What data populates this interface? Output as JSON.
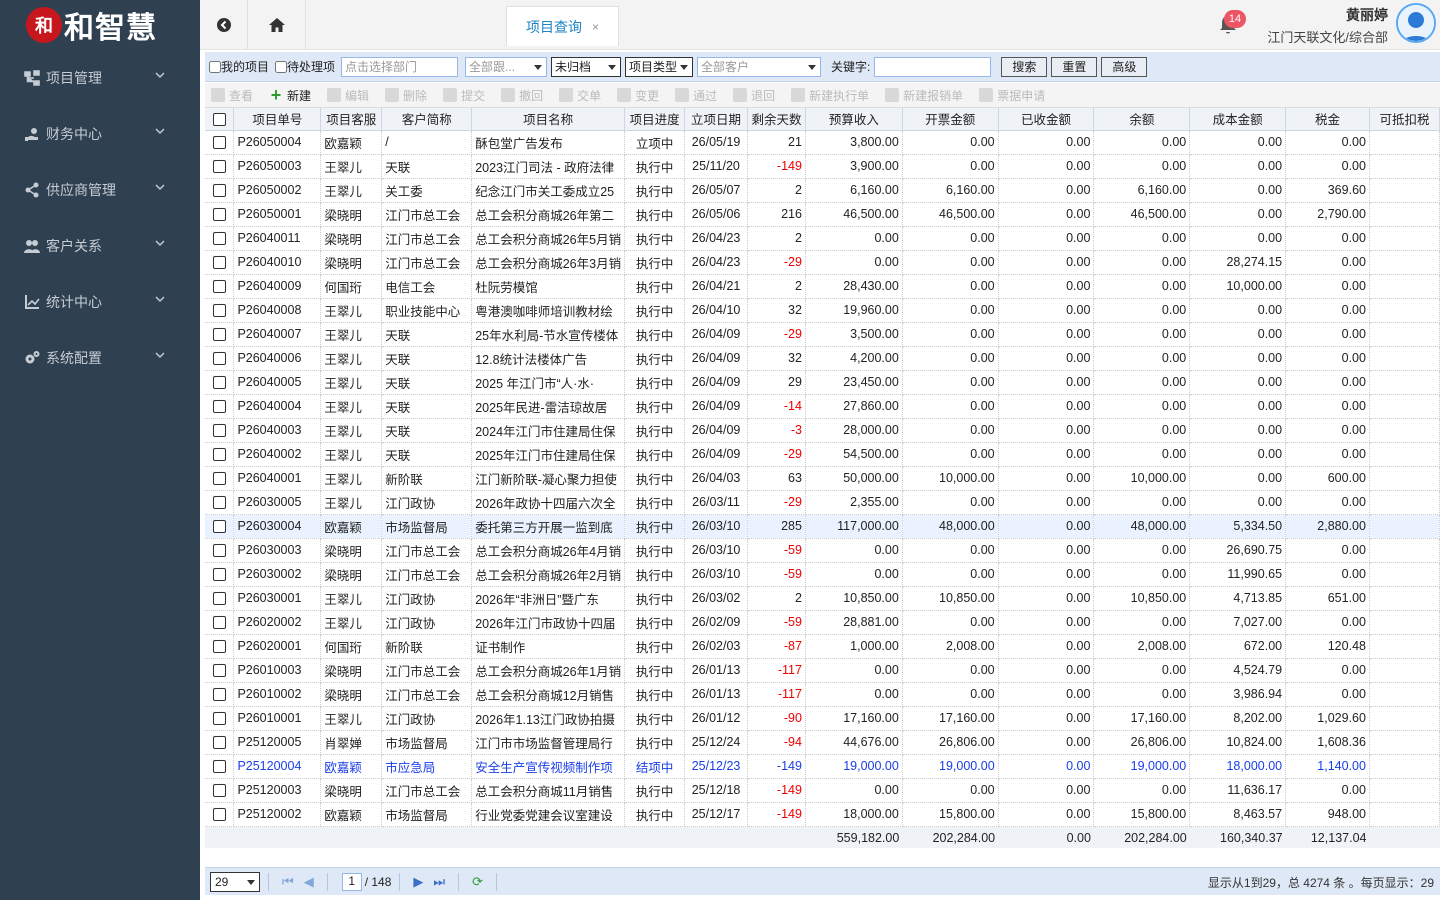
{
  "app": {
    "logo_mark": "和",
    "logo_text": "和智慧"
  },
  "sidebar": {
    "items": [
      {
        "label": "项目管理",
        "icon": "sitemap-icon"
      },
      {
        "label": "财务中心",
        "icon": "hand-money-icon"
      },
      {
        "label": "供应商管理",
        "icon": "share-icon"
      },
      {
        "label": "客户关系",
        "icon": "users-icon"
      },
      {
        "label": "统计中心",
        "icon": "chart-icon"
      },
      {
        "label": "系统配置",
        "icon": "gears-icon"
      }
    ]
  },
  "header": {
    "tab_label": "项目查询",
    "tab_close": "×",
    "notif_count": "14",
    "user_name": "黄丽婷",
    "user_org": "江门天联文化/综合部"
  },
  "filter": {
    "my_projects": "我的项目",
    "pending": "待处理项",
    "dept_placeholder": "点击选择部门",
    "follow": "全部跟...",
    "archive": "未归档",
    "type": "项目类型",
    "client": "全部客户",
    "keyword_label": "关键字:",
    "search": "搜索",
    "reset": "重置",
    "advanced": "高级"
  },
  "toolbar": {
    "items": [
      {
        "label": "查看",
        "enabled": false
      },
      {
        "label": "新建",
        "enabled": true
      },
      {
        "label": "编辑",
        "enabled": false
      },
      {
        "label": "删除",
        "enabled": false
      },
      {
        "label": "提交",
        "enabled": false
      },
      {
        "label": "撤回",
        "enabled": false
      },
      {
        "label": "交单",
        "enabled": false
      },
      {
        "label": "变更",
        "enabled": false
      },
      {
        "label": "通过",
        "enabled": false
      },
      {
        "label": "退回",
        "enabled": false
      },
      {
        "label": "新建执行单",
        "enabled": false
      },
      {
        "label": "新建报销单",
        "enabled": false
      },
      {
        "label": "票据申请",
        "enabled": false
      }
    ]
  },
  "table": {
    "columns": [
      "项目单号",
      "项目客服",
      "客户简称",
      "项目名称",
      "项目进度",
      "立项日期",
      "剩余天数",
      "预算收入",
      "开票金额",
      "已收金额",
      "余额",
      "成本金额",
      "税金",
      "可抵扣税"
    ],
    "rows": [
      [
        "P26050004",
        "欧嘉颖",
        "/",
        "酥包堂广告发布",
        "立项中",
        "26/05/19",
        "21",
        "3,800.00",
        "0.00",
        "0.00",
        "0.00",
        "0.00",
        "0.00",
        ""
      ],
      [
        "P26050003",
        "王翠儿",
        "天联",
        "2023江门司法 - 政府法律",
        "执行中",
        "25/11/20",
        "-149",
        "3,900.00",
        "0.00",
        "0.00",
        "0.00",
        "0.00",
        "0.00",
        ""
      ],
      [
        "P26050002",
        "王翠儿",
        "关工委",
        "纪念江门市关工委成立25",
        "执行中",
        "26/05/07",
        "2",
        "6,160.00",
        "6,160.00",
        "0.00",
        "6,160.00",
        "0.00",
        "369.60",
        ""
      ],
      [
        "P26050001",
        "梁晓明",
        "江门市总工会",
        "总工会积分商城26年第二",
        "执行中",
        "26/05/06",
        "216",
        "46,500.00",
        "46,500.00",
        "0.00",
        "46,500.00",
        "0.00",
        "2,790.00",
        ""
      ],
      [
        "P26040011",
        "梁晓明",
        "江门市总工会",
        "总工会积分商城26年5月销",
        "执行中",
        "26/04/23",
        "2",
        "0.00",
        "0.00",
        "0.00",
        "0.00",
        "0.00",
        "0.00",
        ""
      ],
      [
        "P26040010",
        "梁晓明",
        "江门市总工会",
        "总工会积分商城26年3月销",
        "执行中",
        "26/04/23",
        "-29",
        "0.00",
        "0.00",
        "0.00",
        "0.00",
        "28,274.15",
        "0.00",
        ""
      ],
      [
        "P26040009",
        "何国珩",
        "电信工会",
        "杜阮劳模馆",
        "执行中",
        "26/04/21",
        "2",
        "28,430.00",
        "0.00",
        "0.00",
        "0.00",
        "10,000.00",
        "0.00",
        ""
      ],
      [
        "P26040008",
        "王翠儿",
        "职业技能中心",
        "粤港澳咖啡师培训教材绘",
        "执行中",
        "26/04/10",
        "32",
        "19,960.00",
        "0.00",
        "0.00",
        "0.00",
        "0.00",
        "0.00",
        ""
      ],
      [
        "P26040007",
        "王翠儿",
        "天联",
        "25年水利局-节水宣传楼体",
        "执行中",
        "26/04/09",
        "-29",
        "3,500.00",
        "0.00",
        "0.00",
        "0.00",
        "0.00",
        "0.00",
        ""
      ],
      [
        "P26040006",
        "王翠儿",
        "天联",
        "12.8统计法楼体广告",
        "执行中",
        "26/04/09",
        "32",
        "4,200.00",
        "0.00",
        "0.00",
        "0.00",
        "0.00",
        "0.00",
        ""
      ],
      [
        "P26040005",
        "王翠儿",
        "天联",
        "2025 年江门市“人·水·",
        "执行中",
        "26/04/09",
        "29",
        "23,450.00",
        "0.00",
        "0.00",
        "0.00",
        "0.00",
        "0.00",
        ""
      ],
      [
        "P26040004",
        "王翠儿",
        "天联",
        "2025年民进-雷洁琼故居",
        "执行中",
        "26/04/09",
        "-14",
        "27,860.00",
        "0.00",
        "0.00",
        "0.00",
        "0.00",
        "0.00",
        ""
      ],
      [
        "P26040003",
        "王翠儿",
        "天联",
        "2024年江门市住建局住保",
        "执行中",
        "26/04/09",
        "-3",
        "28,000.00",
        "0.00",
        "0.00",
        "0.00",
        "0.00",
        "0.00",
        ""
      ],
      [
        "P26040002",
        "王翠儿",
        "天联",
        "2025年江门市住建局住保",
        "执行中",
        "26/04/09",
        "-29",
        "54,500.00",
        "0.00",
        "0.00",
        "0.00",
        "0.00",
        "0.00",
        ""
      ],
      [
        "P26040001",
        "王翠儿",
        "新阶联",
        "江门新阶联-凝心聚力担使",
        "执行中",
        "26/04/03",
        "63",
        "50,000.00",
        "10,000.00",
        "0.00",
        "10,000.00",
        "0.00",
        "600.00",
        ""
      ],
      [
        "P26030005",
        "王翠儿",
        "江门政协",
        "2026年政协十四届六次全",
        "执行中",
        "26/03/11",
        "-29",
        "2,355.00",
        "0.00",
        "0.00",
        "0.00",
        "0.00",
        "0.00",
        ""
      ],
      [
        "P26030004",
        "欧嘉颖",
        "市场监督局",
        "委托第三方开展一监到底",
        "执行中",
        "26/03/10",
        "285",
        "117,000.00",
        "48,000.00",
        "0.00",
        "48,000.00",
        "5,334.50",
        "2,880.00",
        ""
      ],
      [
        "P26030003",
        "梁晓明",
        "江门市总工会",
        "总工会积分商城26年4月销",
        "执行中",
        "26/03/10",
        "-59",
        "0.00",
        "0.00",
        "0.00",
        "0.00",
        "26,690.75",
        "0.00",
        ""
      ],
      [
        "P26030002",
        "梁晓明",
        "江门市总工会",
        "总工会积分商城26年2月销",
        "执行中",
        "26/03/10",
        "-59",
        "0.00",
        "0.00",
        "0.00",
        "0.00",
        "11,990.65",
        "0.00",
        ""
      ],
      [
        "P26030001",
        "王翠儿",
        "江门政协",
        "2026年“非洲日”暨广东",
        "执行中",
        "26/03/02",
        "2",
        "10,850.00",
        "10,850.00",
        "0.00",
        "10,850.00",
        "4,713.85",
        "651.00",
        ""
      ],
      [
        "P26020002",
        "王翠儿",
        "江门政协",
        "2026年江门市政协十四届",
        "执行中",
        "26/02/09",
        "-59",
        "28,881.00",
        "0.00",
        "0.00",
        "0.00",
        "7,027.00",
        "0.00",
        ""
      ],
      [
        "P26020001",
        "何国珩",
        "新阶联",
        "证书制作",
        "执行中",
        "26/02/03",
        "-87",
        "1,000.00",
        "2,008.00",
        "0.00",
        "2,008.00",
        "672.00",
        "120.48",
        ""
      ],
      [
        "P26010003",
        "梁晓明",
        "江门市总工会",
        "总工会积分商城26年1月销",
        "执行中",
        "26/01/13",
        "-117",
        "0.00",
        "0.00",
        "0.00",
        "0.00",
        "4,524.79",
        "0.00",
        ""
      ],
      [
        "P26010002",
        "梁晓明",
        "江门市总工会",
        "总工会积分商城12月销售",
        "执行中",
        "26/01/13",
        "-117",
        "0.00",
        "0.00",
        "0.00",
        "0.00",
        "3,986.94",
        "0.00",
        ""
      ],
      [
        "P26010001",
        "王翠儿",
        "江门政协",
        "2026年1.13江门政协拍摄",
        "执行中",
        "26/01/12",
        "-90",
        "17,160.00",
        "17,160.00",
        "0.00",
        "17,160.00",
        "8,202.00",
        "1,029.60",
        ""
      ],
      [
        "P25120005",
        "肖翠婵",
        "市场监督局",
        "江门市市场监督管理局行",
        "执行中",
        "25/12/24",
        "-94",
        "44,676.00",
        "26,806.00",
        "0.00",
        "26,806.00",
        "10,824.00",
        "1,608.36",
        ""
      ],
      [
        "P25120004",
        "欧嘉颖",
        "市应急局",
        "安全生产宣传视频制作项",
        "结项中",
        "25/12/23",
        "-149",
        "19,000.00",
        "19,000.00",
        "0.00",
        "19,000.00",
        "18,000.00",
        "1,140.00",
        ""
      ],
      [
        "P25120003",
        "梁晓明",
        "江门市总工会",
        "总工会积分商城11月销售",
        "执行中",
        "25/12/18",
        "-149",
        "0.00",
        "0.00",
        "0.00",
        "0.00",
        "11,636.17",
        "0.00",
        ""
      ],
      [
        "P25120002",
        "欧嘉颖",
        "市场监督局",
        "行业党委党建会议室建设",
        "执行中",
        "25/12/17",
        "-149",
        "18,000.00",
        "15,800.00",
        "0.00",
        "15,800.00",
        "8,463.57",
        "948.00",
        ""
      ]
    ],
    "totals": [
      "",
      "",
      "",
      "",
      "",
      "",
      "",
      "559,182.00",
      "202,284.00",
      "0.00",
      "202,284.00",
      "160,340.37",
      "12,137.04",
      ""
    ],
    "selected_row": 16,
    "blue_row": 26
  },
  "pager": {
    "page_size": "29",
    "current_page": "1",
    "total_pages": "/ 148",
    "info": "显示从1到29，总 4274 条 。每页显示：29"
  },
  "colors": {
    "sidebar": "#2f4050",
    "accent": "#1c84c6",
    "negative": "#e00000",
    "link_row": "#1a3ee8"
  }
}
